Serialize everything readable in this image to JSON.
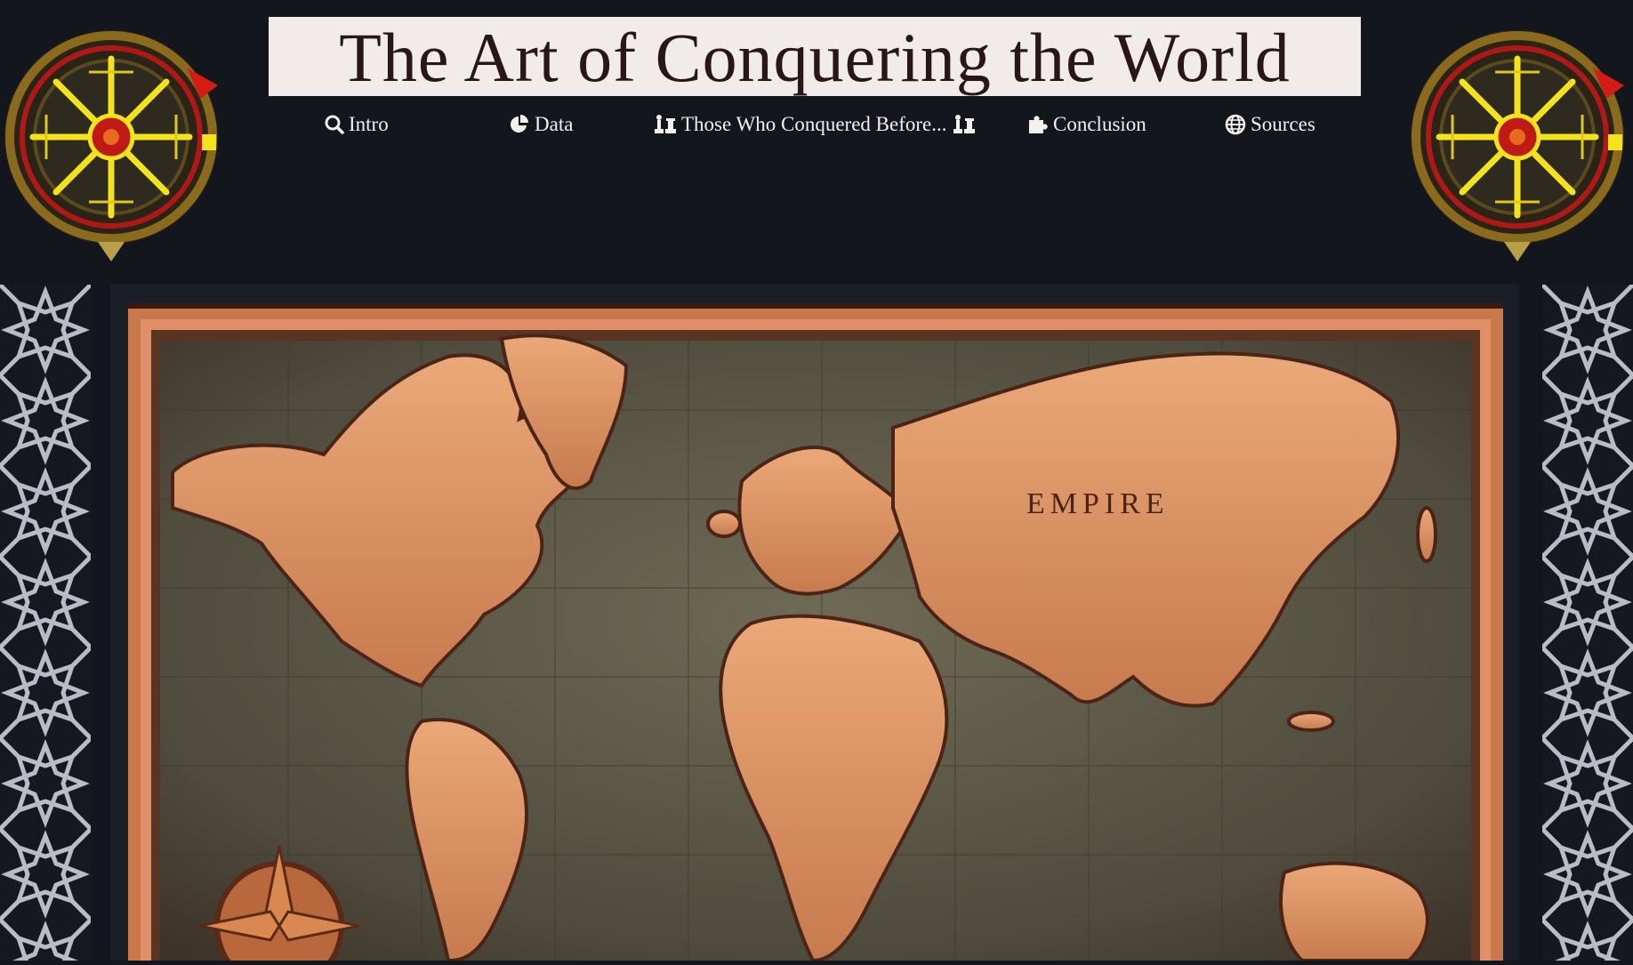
{
  "header": {
    "title": "The Art of Conquering the World"
  },
  "nav": {
    "items": [
      {
        "label": "Intro",
        "icon": "search-icon"
      },
      {
        "label": "Data",
        "icon": "pie-chart-icon"
      },
      {
        "label": "Those Who Conquered Before...",
        "icon": "chess-pieces-icon"
      },
      {
        "label": "Conclusion",
        "icon": "puzzle-icon"
      },
      {
        "label": "Sources",
        "icon": "globe-icon"
      }
    ]
  },
  "colors": {
    "background": "#13161d",
    "title_bg": "#f1ecea",
    "title_text": "#2a1616",
    "nav_text": "#f3f0ee",
    "pattern": "#b9bcc4"
  },
  "map": {
    "label_fragment": "EMPIRE"
  }
}
